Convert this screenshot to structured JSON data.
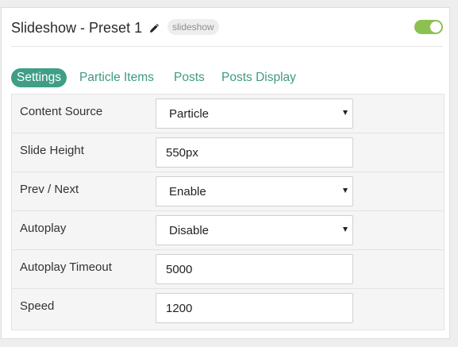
{
  "header": {
    "title": "Slideshow - Preset 1",
    "badge": "slideshow",
    "pencil_icon": "pencil-icon",
    "toggle_state": "on",
    "toggle_color": "#8cc152"
  },
  "tabs": [
    {
      "label": "Settings",
      "active": true
    },
    {
      "label": "Particle Items",
      "active": false
    },
    {
      "label": "Posts",
      "active": false
    },
    {
      "label": "Posts Display",
      "active": false
    }
  ],
  "colors": {
    "accent": "#3f9e86",
    "tab_text": "#3d9a83"
  },
  "fields": [
    {
      "label": "Content Source",
      "type": "select",
      "value": "Particle"
    },
    {
      "label": "Slide Height",
      "type": "text",
      "value": "550px"
    },
    {
      "label": "Prev / Next",
      "type": "select",
      "value": "Enable"
    },
    {
      "label": "Autoplay",
      "type": "select",
      "value": "Disable"
    },
    {
      "label": "Autoplay Timeout",
      "type": "text",
      "value": "5000"
    },
    {
      "label": "Speed",
      "type": "text",
      "value": "1200"
    }
  ]
}
